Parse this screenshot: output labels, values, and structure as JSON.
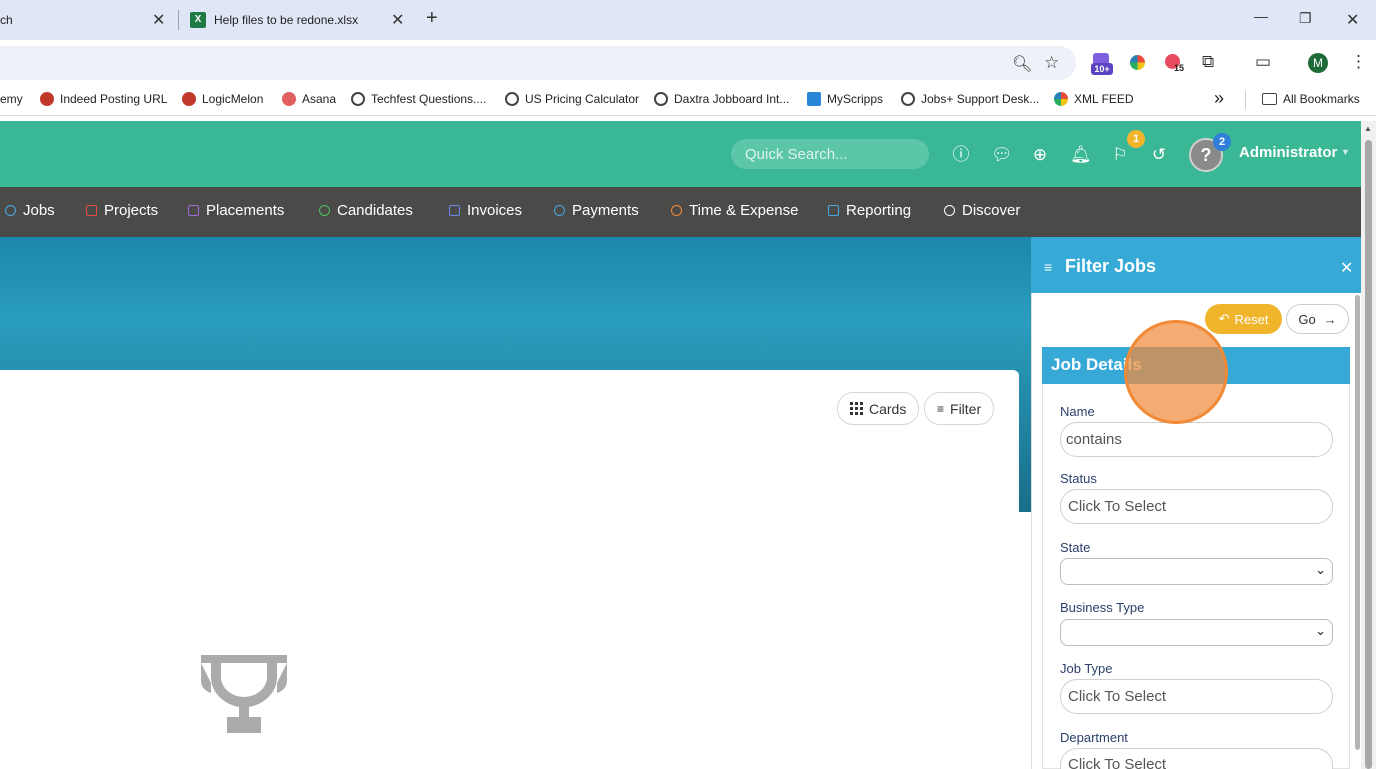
{
  "browser": {
    "tabs": [
      {
        "label": "ch"
      },
      {
        "label": "Help files to be redone.xlsx"
      }
    ],
    "new_tab": "+",
    "window_controls": {
      "minimize": "—",
      "maximize": "❐",
      "close": "✕"
    },
    "extension_badges": {
      "ext1": "10+",
      "ext2": "15"
    },
    "profile_initial": "M",
    "bookmarks": [
      {
        "label": "emy"
      },
      {
        "label": "Indeed Posting URL"
      },
      {
        "label": "LogicMelon"
      },
      {
        "label": "Asana"
      },
      {
        "label": "Techfest Questions...."
      },
      {
        "label": "US Pricing Calculator"
      },
      {
        "label": "Daxtra Jobboard Int..."
      },
      {
        "label": "MyScripps"
      },
      {
        "label": "Jobs+ Support Desk..."
      },
      {
        "label": "XML FEED"
      }
    ],
    "more_bookmarks": "»",
    "all_bookmarks": "All Bookmarks"
  },
  "header": {
    "search_placeholder": "Quick Search...",
    "flag_badge": "1",
    "avatar_badge": "2",
    "user_name": "Administrator"
  },
  "nav": {
    "items": [
      {
        "label": "Jobs",
        "color": "#4aa8e8"
      },
      {
        "label": "Projects",
        "color": "#e84a4a"
      },
      {
        "label": "Placements",
        "color": "#a06ad8"
      },
      {
        "label": "Candidates",
        "color": "#4ec060"
      },
      {
        "label": "Invoices",
        "color": "#6b8ae8"
      },
      {
        "label": "Payments",
        "color": "#4aa8e8"
      },
      {
        "label": "Time & Expense",
        "color": "#f08a36"
      },
      {
        "label": "Reporting",
        "color": "#4aa8e8"
      },
      {
        "label": "Discover",
        "color": "#ffffff"
      }
    ]
  },
  "main": {
    "cards_label": "Cards",
    "filter_label": "Filter"
  },
  "filter_panel": {
    "title": "Filter Jobs",
    "close": "✕",
    "reset_label": "Reset",
    "go_label": "Go",
    "section_title": "Job Details",
    "fields": {
      "name_label": "Name",
      "name_value": "contains",
      "status_label": "Status",
      "status_placeholder": "Click To Select",
      "state_label": "State",
      "business_type_label": "Business Type",
      "job_type_label": "Job Type",
      "job_type_placeholder": "Click To Select",
      "department_label": "Department",
      "department_placeholder": "Click To Select"
    }
  },
  "colors": {
    "header_green": "#3ab795",
    "nav_dark": "#4a4a48",
    "panel_blue": "#36a9d6",
    "reset_yellow": "#f1b52b",
    "highlight_orange": "#f08a36"
  }
}
